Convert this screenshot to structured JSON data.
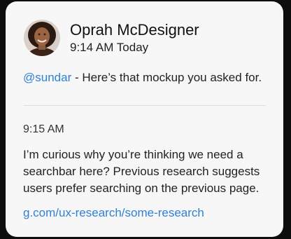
{
  "post": {
    "author": "Oprah McDesigner",
    "timestamp": "9:14 AM Today",
    "mention": "@sundar",
    "message": " - Here’s that mockup you asked for."
  },
  "reply": {
    "timestamp": "9:15 AM",
    "lines": [
      "I’m curious why you’re thinking we need a",
      "searchbar here? Previous research suggests",
      "users prefer searching on the previous page."
    ],
    "link": "g.com/ux-research/some-research"
  },
  "colors": {
    "link": "#2f80d6",
    "card_background": "#f7f7f7",
    "page_background": "#0d0d0d"
  }
}
